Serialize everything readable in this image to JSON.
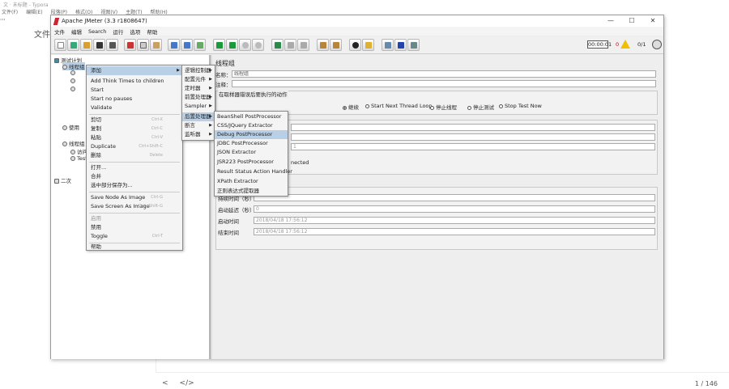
{
  "background": {
    "title": "文 · 未标题 - Typora",
    "menu": [
      "文件(F)",
      "编辑(E)",
      "段落(P)",
      "格式(O)",
      "视图(V)",
      "主题(T)",
      "帮助(H)"
    ],
    "file_label": "文件",
    "page_indicator": "1 / 146",
    "nav_back": "<",
    "nav_code": "</>"
  },
  "window": {
    "title": "Apache JMeter (3.3 r1808647)",
    "minimize": "—",
    "maximize": "☐",
    "close": "✕",
    "menu": [
      "文件",
      "编辑",
      "Search",
      "运行",
      "选项",
      "帮助"
    ],
    "timer": "00:00:01",
    "warnings": "0",
    "threads": "0/1"
  },
  "tree": {
    "test_plan": "测试计划",
    "thread_group": "线程组",
    "items": [
      "使用",
      "线程组",
      "访问",
      "Test",
      "二次"
    ]
  },
  "panel": {
    "title": "线程组",
    "name_label": "名称：",
    "name_value": "线程组",
    "comment_label": "注释：",
    "action_label": "在取样器错误后要执行的动作",
    "actions": [
      "继续",
      "Start Next Thread Loop",
      "停止线程",
      "停止测试",
      "Stop Test Now"
    ],
    "thread_props": "nected",
    "field_value": "1",
    "scheduler_rows": [
      "持续时间（秒）",
      "启动延迟（秒）",
      "启动时间",
      "结束时间"
    ],
    "scheduler_values": [
      "",
      "0",
      "2018/04/18 17:56:12",
      "2018/04/18 17:56:12"
    ]
  },
  "context_menu": {
    "items": [
      {
        "label": "添加",
        "arrow": "▶"
      },
      {
        "label": "Add Think Times to children"
      },
      {
        "label": "Start"
      },
      {
        "label": "Start no pauses"
      },
      {
        "label": "Validate"
      },
      {
        "label": "剪切",
        "shortcut": "Ctrl-X"
      },
      {
        "label": "复制",
        "shortcut": "Ctrl-C"
      },
      {
        "label": "粘贴",
        "shortcut": "Ctrl-V"
      },
      {
        "label": "Duplicate",
        "shortcut": "Ctrl+Shift-C"
      },
      {
        "label": "删除",
        "shortcut": "Delete"
      },
      {
        "label": "打开..."
      },
      {
        "label": "合并"
      },
      {
        "label": "选中部分保存为..."
      },
      {
        "label": "Save Node As Image",
        "shortcut": "Ctrl-G"
      },
      {
        "label": "Save Screen As Image",
        "shortcut": "Ctrl+Shift-G"
      },
      {
        "label": "启用"
      },
      {
        "label": "禁用"
      },
      {
        "label": "Toggle",
        "shortcut": "Ctrl-T"
      },
      {
        "label": "帮助"
      }
    ]
  },
  "add_submenu": {
    "items": [
      {
        "label": "逻辑控制器",
        "arrow": "▶"
      },
      {
        "label": "配置元件",
        "arrow": "▶"
      },
      {
        "label": "定时器",
        "arrow": "▶"
      },
      {
        "label": "前置处理器",
        "arrow": "▶"
      },
      {
        "label": "Sampler",
        "arrow": "▶"
      },
      {
        "label": "后置处理器",
        "arrow": "▶"
      },
      {
        "label": "断言",
        "arrow": "▶"
      },
      {
        "label": "监听器",
        "arrow": "▶"
      }
    ]
  },
  "post_submenu": {
    "items": [
      "BeanShell PostProcessor",
      "CSS/JQuery Extractor",
      "Debug PostProcessor",
      "JDBC PostProcessor",
      "JSON Extractor",
      "JSR223 PostProcessor",
      "Result Status Action Handler",
      "XPath Extractor",
      "正则表达式提取器"
    ]
  }
}
